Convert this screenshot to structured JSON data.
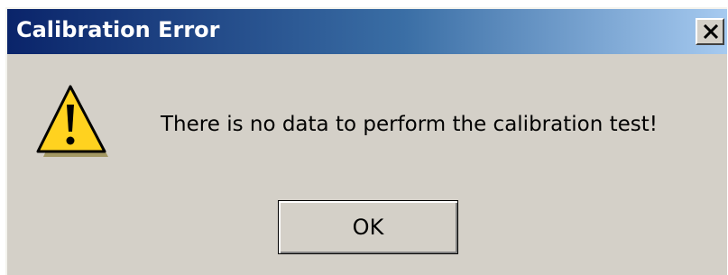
{
  "window": {
    "title": "Calibration Error",
    "close_icon": "close-icon"
  },
  "dialog": {
    "icon": "warning-icon",
    "message": "There is no data to perform the calibration test!",
    "ok_label": "OK"
  },
  "colors": {
    "titlebar_start": "#0a246a",
    "titlebar_end": "#a6caf0",
    "dialog_background": "#d4d0c8",
    "warning_yellow": "#ffd21f"
  }
}
